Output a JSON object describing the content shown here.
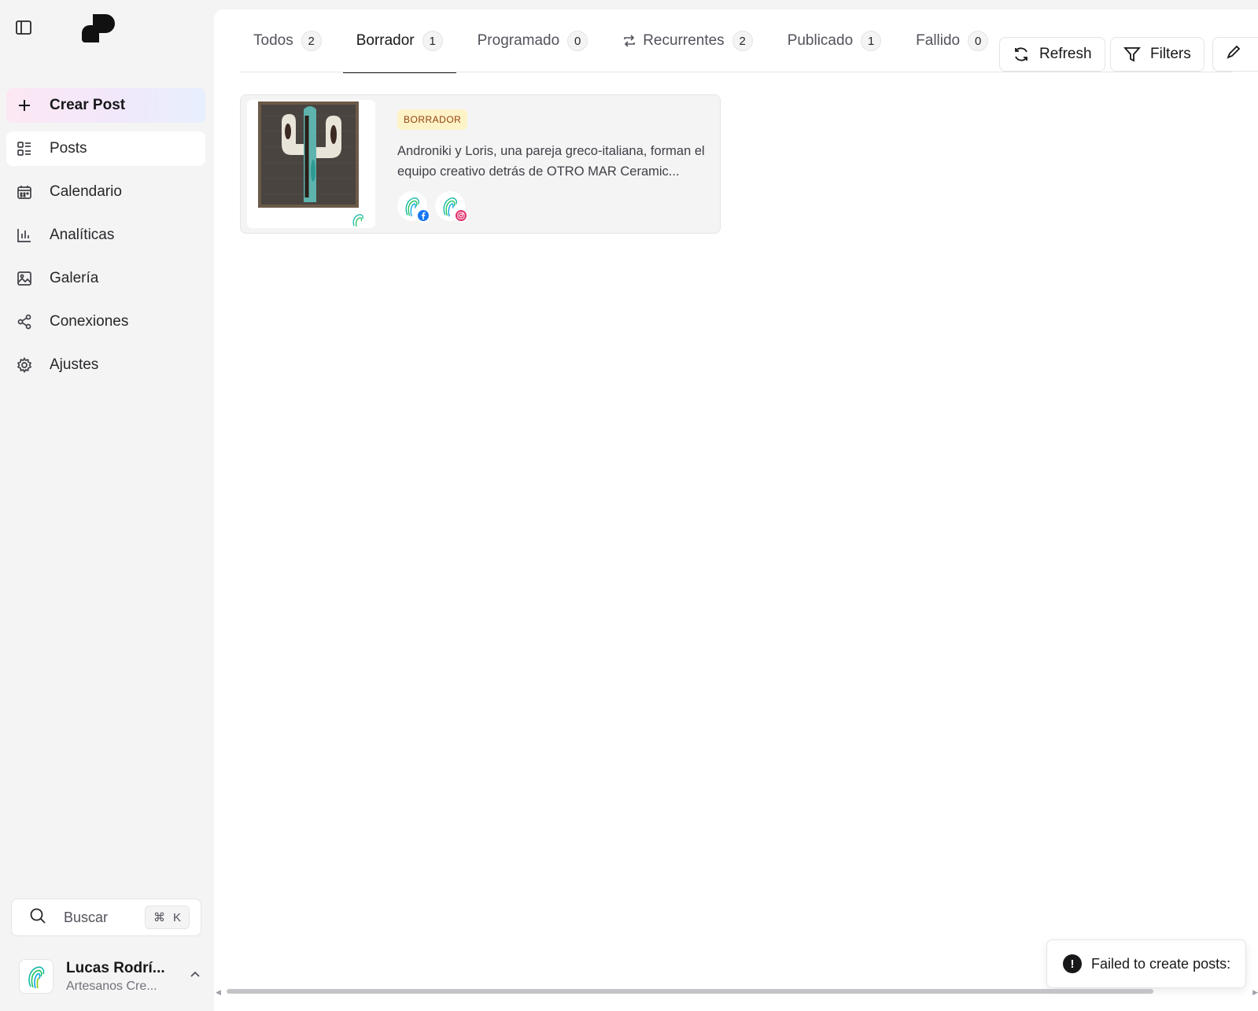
{
  "sidebar": {
    "items": [
      {
        "label": "Crear Post",
        "icon": "plus-icon"
      },
      {
        "label": "Posts",
        "icon": "posts-list-icon"
      },
      {
        "label": "Calendario",
        "icon": "calendar-icon"
      },
      {
        "label": "Analíticas",
        "icon": "bar-chart-icon"
      },
      {
        "label": "Galería",
        "icon": "image-icon"
      },
      {
        "label": "Conexiones",
        "icon": "share-icon"
      },
      {
        "label": "Ajustes",
        "icon": "gear-icon"
      }
    ],
    "search": {
      "placeholder": "Buscar",
      "shortcut_symbol": "⌘",
      "shortcut_key": "K"
    },
    "user": {
      "name": "Lucas Rodrí...",
      "org": "Artesanos Cre..."
    }
  },
  "tabs": [
    {
      "label": "Todos",
      "count": "2"
    },
    {
      "label": "Borrador",
      "count": "1"
    },
    {
      "label": "Programado",
      "count": "0"
    },
    {
      "label": "Recurrentes",
      "count": "2"
    },
    {
      "label": "Publicado",
      "count": "1"
    },
    {
      "label": "Fallido",
      "count": "0"
    }
  ],
  "toolbar": {
    "refresh_label": "Refresh",
    "filters_label": "Filters"
  },
  "post": {
    "status": "BORRADOR",
    "text": "Androniki y Loris, una pareja greco-italiana, forman el equipo creativo detrás de OTRO MAR Ceramic...",
    "networks": [
      "facebook",
      "instagram"
    ]
  },
  "toast": {
    "message": "Failed to create posts:"
  },
  "colors": {
    "facebook": "#1877f2",
    "instagram": "#e1306c",
    "badge_bg": "#fef3c7",
    "badge_text": "#92400e"
  }
}
